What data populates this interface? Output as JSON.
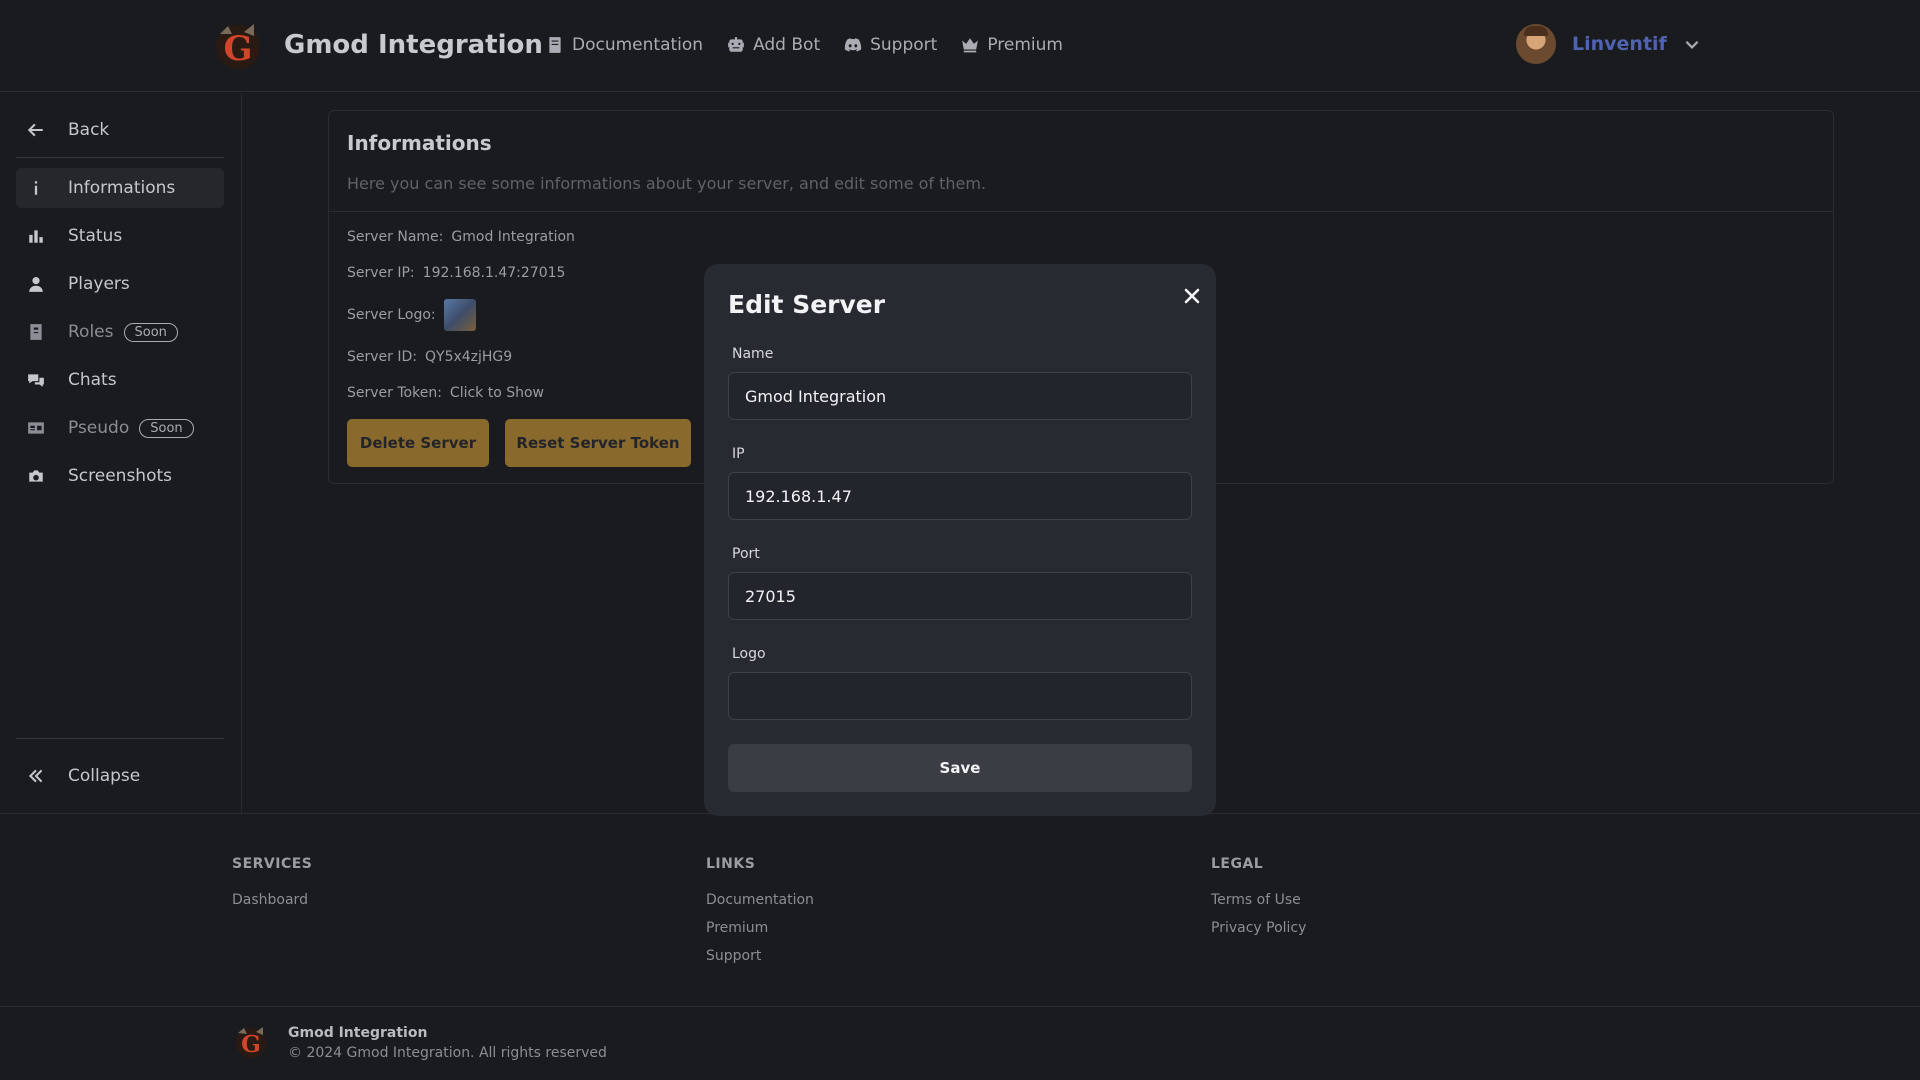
{
  "header": {
    "brand": "Gmod Integration",
    "nav": [
      {
        "label": "Documentation",
        "icon": "book-icon"
      },
      {
        "label": "Add Bot",
        "icon": "robot-icon"
      },
      {
        "label": "Support",
        "icon": "discord-icon"
      },
      {
        "label": "Premium",
        "icon": "crown-icon"
      }
    ],
    "user": {
      "name": "Linventif"
    }
  },
  "sidebar": {
    "back": "Back",
    "items": [
      {
        "label": "Informations",
        "icon": "info-icon",
        "active": true
      },
      {
        "label": "Status",
        "icon": "bar-chart-icon"
      },
      {
        "label": "Players",
        "icon": "user-icon"
      },
      {
        "label": "Roles",
        "icon": "roles-icon",
        "badge": "Soon"
      },
      {
        "label": "Chats",
        "icon": "chat-icon"
      },
      {
        "label": "Pseudo",
        "icon": "id-card-icon",
        "badge": "Soon"
      },
      {
        "label": "Screenshots",
        "icon": "camera-icon"
      }
    ],
    "collapse": "Collapse"
  },
  "main": {
    "title": "Informations",
    "subtitle": "Here you can see some informations about your server, and edit some of them.",
    "fields": {
      "server_name_label": "Server Name:",
      "server_name": "Gmod Integration",
      "server_ip_label": "Server IP:",
      "server_ip": "192.168.1.47:27015",
      "server_logo_label": "Server Logo:",
      "server_id_label": "Server ID:",
      "server_id": "QY5x4zjHG9",
      "server_token_label": "Server Token:",
      "server_token": "Click to Show"
    },
    "buttons": {
      "delete": "Delete Server",
      "reset_token": "Reset Server Token"
    }
  },
  "modal": {
    "title": "Edit Server",
    "name_label": "Name",
    "name_value": "Gmod Integration",
    "ip_label": "IP",
    "ip_value": "192.168.1.47",
    "port_label": "Port",
    "port_value": "27015",
    "logo_label": "Logo",
    "logo_value": "",
    "save": "Save"
  },
  "footer": {
    "services_title": "SERVICES",
    "services": [
      "Dashboard"
    ],
    "links_title": "LINKS",
    "links": [
      "Documentation",
      "Premium",
      "Support"
    ],
    "legal_title": "LEGAL",
    "legal": [
      "Terms of Use",
      "Privacy Policy"
    ],
    "brand": "Gmod Integration",
    "copyright": "© 2024 Gmod Integration. All rights reserved"
  },
  "colors": {
    "background": "#1a1b1f",
    "accent_amber": "#8a6a2c",
    "username_blue": "#4f63b0",
    "modal_bg": "#272a31"
  }
}
